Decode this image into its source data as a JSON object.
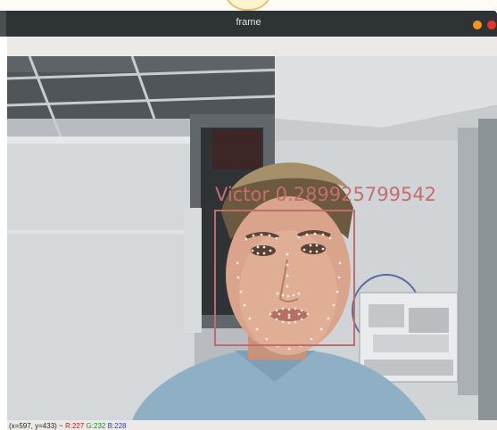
{
  "window": {
    "title": "frame",
    "controls": {
      "minimize_color": "#f6921e",
      "close_color": "#e8332a"
    }
  },
  "overlay": {
    "label": "Victor 0.289925799542",
    "box_color": "#c06c6c"
  },
  "status": {
    "coords": "(x=597, y=433) ~",
    "r": "R:227",
    "g": "G:232",
    "b": "B:228"
  }
}
